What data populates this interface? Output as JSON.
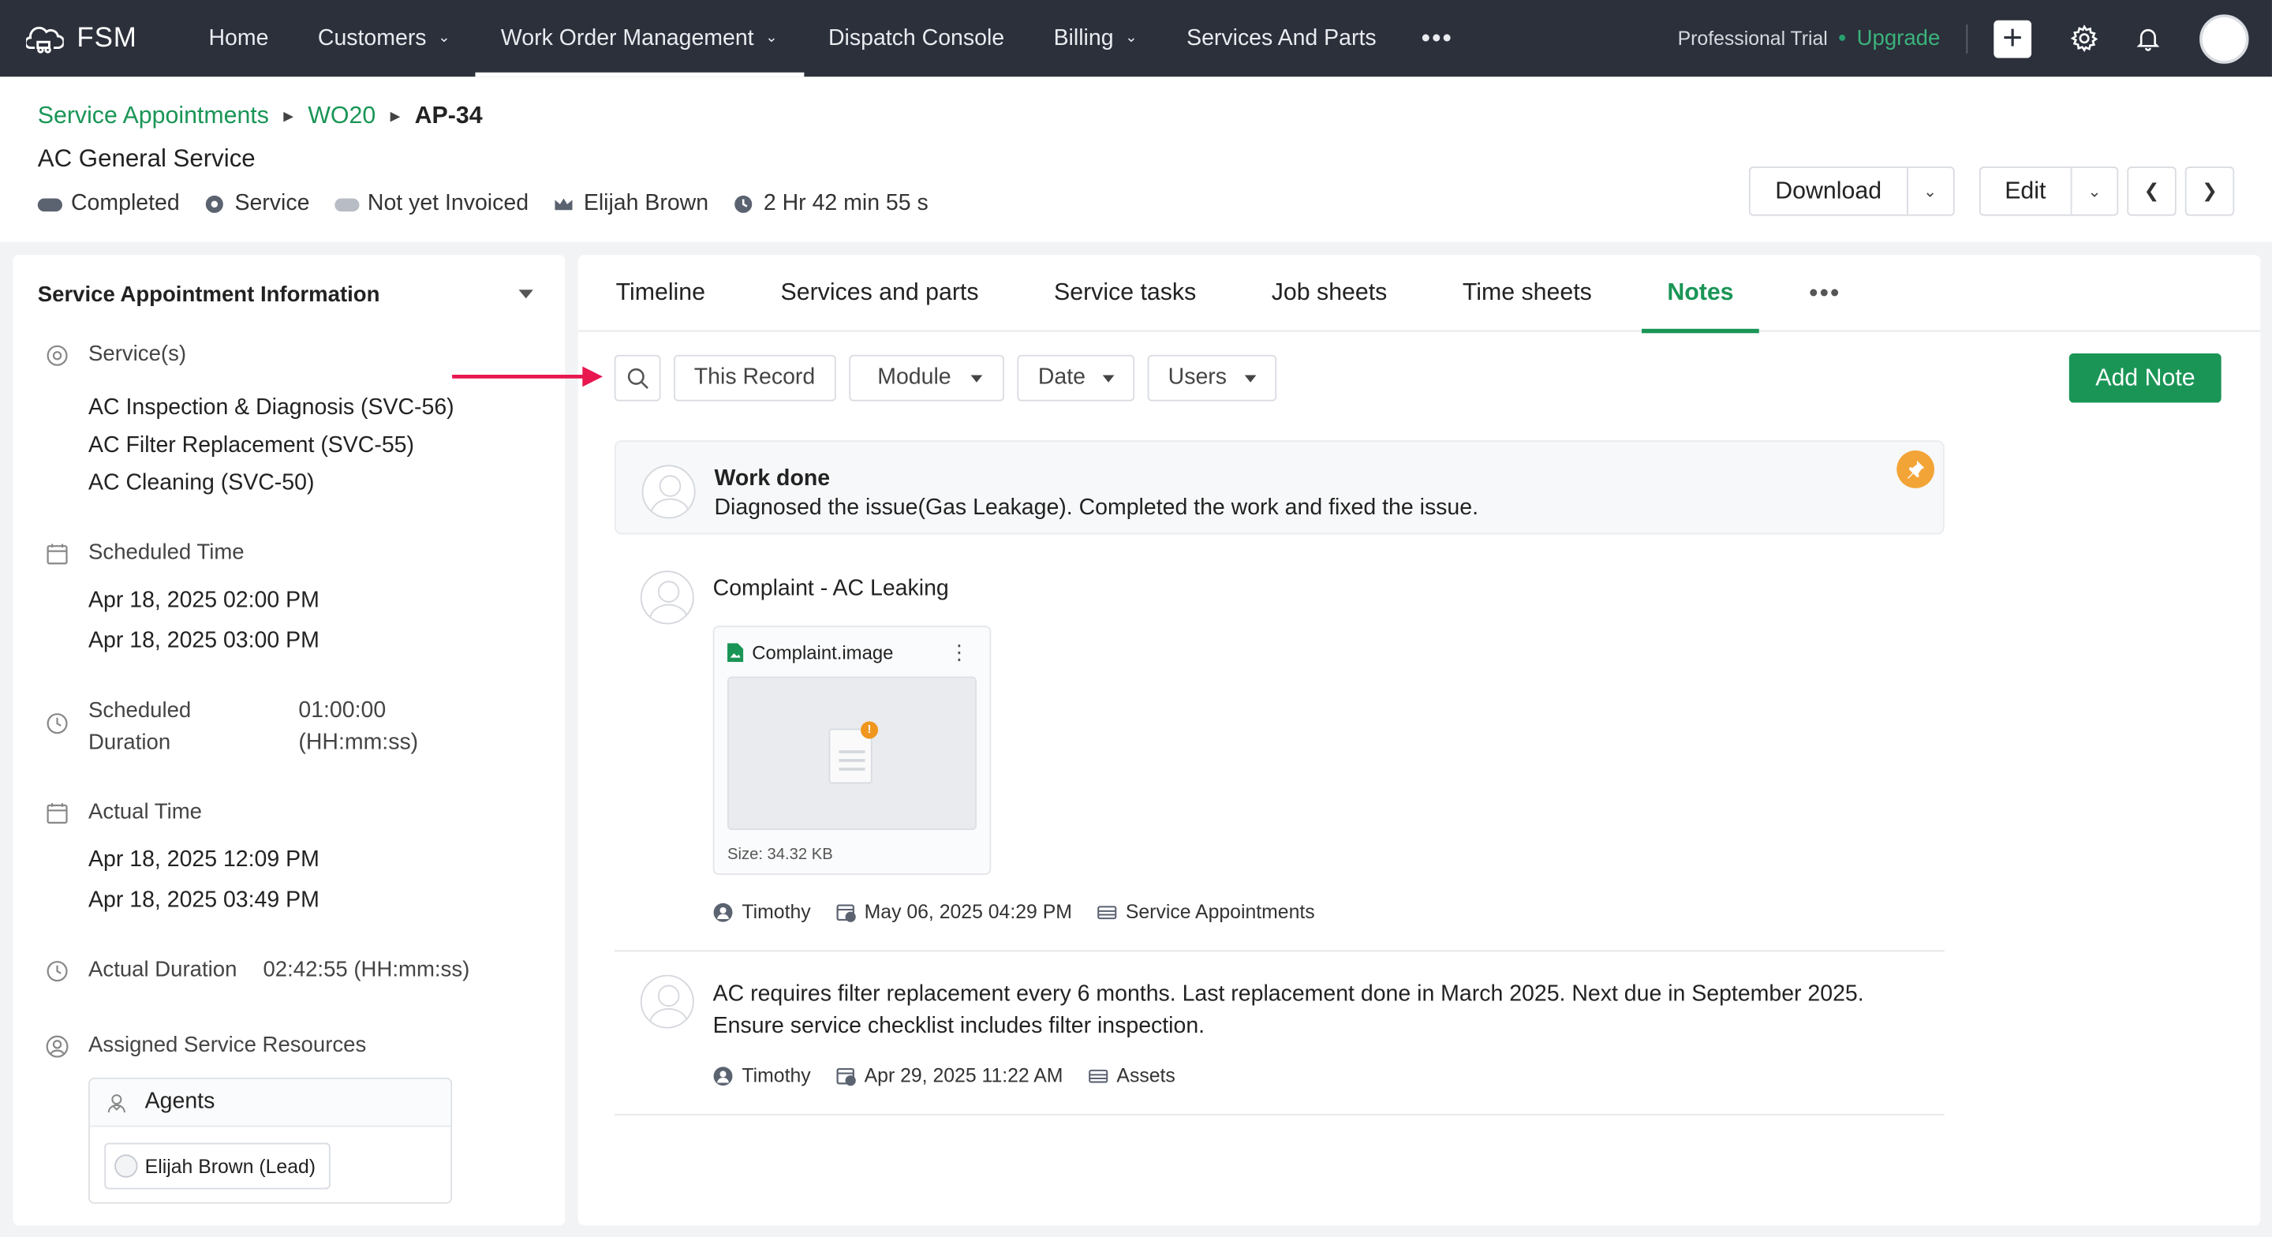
{
  "topbar": {
    "logo": "FSM",
    "nav": [
      {
        "label": "Home",
        "chevron": false,
        "active": false
      },
      {
        "label": "Customers",
        "chevron": true,
        "active": false
      },
      {
        "label": "Work Order Management",
        "chevron": true,
        "active": true
      },
      {
        "label": "Dispatch Console",
        "chevron": false,
        "active": false
      },
      {
        "label": "Billing",
        "chevron": true,
        "active": false
      },
      {
        "label": "Services And Parts",
        "chevron": false,
        "active": false
      }
    ],
    "more": "•••",
    "trial": "Professional Trial",
    "upgrade": "Upgrade"
  },
  "breadcrumb": {
    "level1": "Service Appointments",
    "level2": "WO20",
    "current": "AP-34"
  },
  "record": {
    "title": "AC General Service",
    "status": "Completed",
    "type": "Service",
    "invoice": "Not yet Invoiced",
    "assignee": "Elijah Brown",
    "duration": "2 Hr 42 min 55 s"
  },
  "actions": {
    "download": "Download",
    "edit": "Edit"
  },
  "info_panel": {
    "title": "Service Appointment Information",
    "services_label": "Service(s)",
    "services": [
      "AC Inspection & Diagnosis (SVC-56)",
      "AC Filter Replacement (SVC-55)",
      "AC Cleaning (SVC-50)"
    ],
    "scheduled_time_label": "Scheduled Time",
    "scheduled_start": "Apr 18, 2025 02:00 PM",
    "scheduled_end": "Apr 18, 2025 03:00 PM",
    "scheduled_duration_label_1": "Scheduled",
    "scheduled_duration_label_2": "Duration",
    "scheduled_duration_value_1": "01:00:00",
    "scheduled_duration_value_2": "(HH:mm:ss)",
    "actual_time_label": "Actual Time",
    "actual_start": "Apr 18, 2025 12:09 PM",
    "actual_end": "Apr 18, 2025 03:49 PM",
    "actual_duration_label": "Actual Duration",
    "actual_duration_value": "02:42:55 (HH:mm:ss)",
    "resources_label": "Assigned Service Resources",
    "agents_label": "Agents",
    "agent": "Elijah Brown (Lead)"
  },
  "tabs": [
    {
      "label": "Timeline",
      "active": false
    },
    {
      "label": "Services and parts",
      "active": false
    },
    {
      "label": "Service tasks",
      "active": false
    },
    {
      "label": "Job sheets",
      "active": false
    },
    {
      "label": "Time sheets",
      "active": false
    },
    {
      "label": "Notes",
      "active": true
    }
  ],
  "tabs_more": "•••",
  "filters": {
    "record": "This Record",
    "module": "Module",
    "date": "Date",
    "users": "Users",
    "add_note": "Add Note"
  },
  "notes": [
    {
      "title": "Work done",
      "body": "Diagnosed the issue(Gas Leakage). Completed the work and fixed the issue.",
      "pinned": true
    },
    {
      "title": "Complaint - AC Leaking",
      "attachment": {
        "name": "Complaint.image",
        "size": "Size: 34.32 KB"
      },
      "author": "Timothy",
      "date": "May 06, 2025 04:29 PM",
      "module": "Service Appointments"
    },
    {
      "body_line1": "AC requires filter replacement every 6 months. Last replacement done in March 2025. Next due in September 2025.",
      "body_line2": "Ensure service checklist includes filter inspection.",
      "author": "Timothy",
      "date": "Apr 29, 2025 11:22 AM",
      "module": "Assets"
    }
  ],
  "colors": {
    "accent": "#1a9556",
    "topbar": "#2b303b",
    "pin": "#f3a437",
    "annotation_arrow": "#e8174f"
  }
}
